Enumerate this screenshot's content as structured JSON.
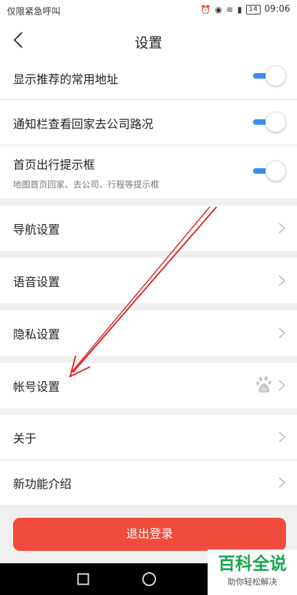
{
  "statusbar": {
    "carrier": "仅限紧急呼叫",
    "battery": "14",
    "time": "09:06"
  },
  "header": {
    "title": "设置"
  },
  "toggle_rows": [
    {
      "label": "显示推荐的常用地址",
      "on": true
    },
    {
      "label": "通知栏查看回家去公司路况",
      "on": true
    },
    {
      "label": "首页出行提示框",
      "subtitle": "地图首页回家、去公司、行程等提示框",
      "on": true
    }
  ],
  "menu_rows": [
    {
      "label": "导航设置"
    },
    {
      "label": "语音设置"
    },
    {
      "label": "隐私设置"
    },
    {
      "label": "帐号设置",
      "icon": "baidu-paw-icon"
    },
    {
      "label": "关于"
    },
    {
      "label": "新功能介绍"
    }
  ],
  "logout_label": "退出登录",
  "watermark": {
    "title": "百科全说",
    "subtitle": "助你轻松解决"
  },
  "colors": {
    "accent": "#3b8cf0",
    "logout": "#f14c3b",
    "annotation": "#e02020"
  }
}
